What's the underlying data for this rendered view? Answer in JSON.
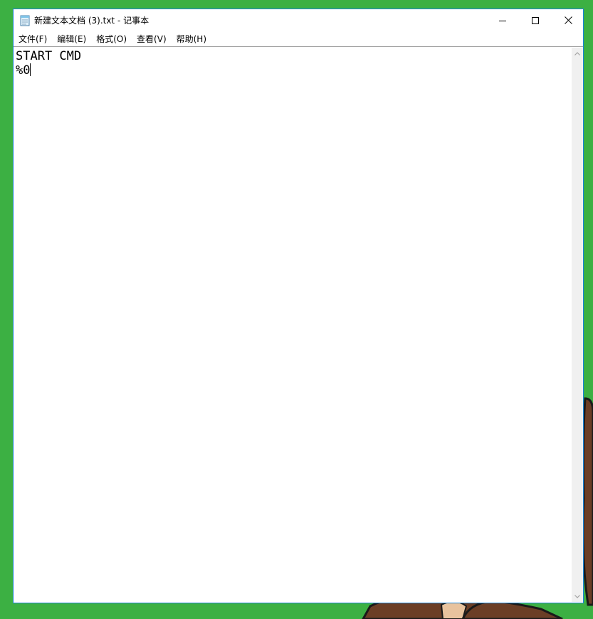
{
  "window": {
    "title": "新建文本文档 (3).txt - 记事本"
  },
  "menu": {
    "items": [
      {
        "label": "文件(F)"
      },
      {
        "label": "编辑(E)"
      },
      {
        "label": "格式(O)"
      },
      {
        "label": "查看(V)"
      },
      {
        "label": "帮助(H)"
      }
    ]
  },
  "editor": {
    "lines": [
      "START CMD",
      "%0"
    ]
  },
  "colors": {
    "desktop": "#3cb043",
    "window_border": "#1883d7",
    "scrollbar": "#f0f0f0"
  },
  "icons": {
    "app": "notepad-icon",
    "minimize": "minimize-icon",
    "maximize": "maximize-icon",
    "close": "close-icon",
    "scroll_up": "chevron-up-icon",
    "scroll_down": "chevron-down-icon"
  }
}
